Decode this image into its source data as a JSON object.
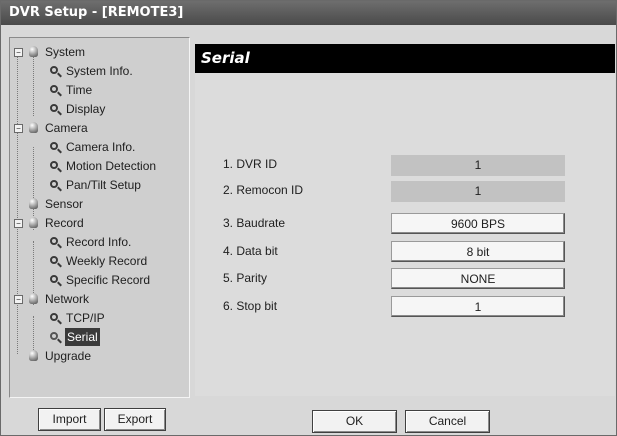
{
  "window": {
    "title": "DVR Setup - [REMOTE3]"
  },
  "tree": {
    "system": "System",
    "system_info": "System Info.",
    "time": "Time",
    "display": "Display",
    "camera": "Camera",
    "camera_info": "Camera Info.",
    "motion_detection": "Motion Detection",
    "pan_tilt_setup": "Pan/Tilt Setup",
    "sensor": "Sensor",
    "record": "Record",
    "record_info": "Record Info.",
    "weekly_record": "Weekly Record",
    "specific_record": "Specific Record",
    "network": "Network",
    "tcpip": "TCP/IP",
    "serial": "Serial",
    "upgrade": "Upgrade",
    "toggle_symbol": "−"
  },
  "panel": {
    "title": "Serial",
    "rows": [
      {
        "label": "1. DVR ID",
        "value": "1"
      },
      {
        "label": "2. Remocon ID",
        "value": "1"
      },
      {
        "label": "3. Baudrate",
        "value": "9600 BPS"
      },
      {
        "label": "4. Data bit",
        "value": "8 bit"
      },
      {
        "label": "5. Parity",
        "value": "NONE"
      },
      {
        "label": "6. Stop bit",
        "value": "1"
      }
    ]
  },
  "buttons": {
    "import": "Import",
    "export": "Export",
    "ok": "OK",
    "cancel": "Cancel"
  }
}
